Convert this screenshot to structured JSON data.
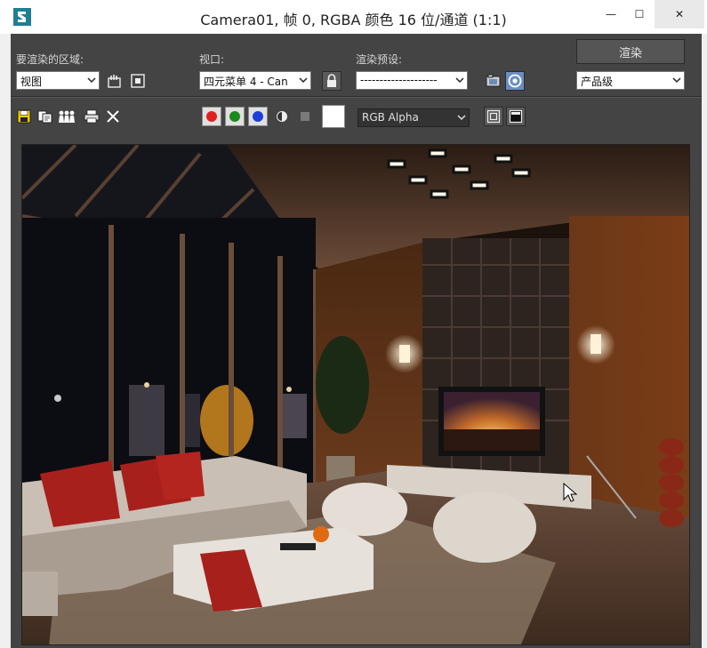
{
  "window": {
    "title": "Camera01, 帧 0, RGBA 颜色 16 位/通道 (1:1)",
    "minimize": "—",
    "maximize": "☐",
    "close": "✕"
  },
  "controls": {
    "area_label": "要渲染的区域:",
    "area_value": "视图",
    "viewport_label": "视口:",
    "viewport_value": "四元菜单 4 - Can",
    "preset_label": "渲染预设:",
    "preset_value": "--------------------",
    "render_button": "渲染",
    "quality_value": "产品级",
    "channel_value": "RGB Alpha"
  },
  "icons": {
    "save": "save-icon",
    "copy": "copy-icon",
    "clone": "clone-window-icon",
    "print": "print-icon",
    "clear": "clear-icon",
    "region_edit": "edit-region-icon",
    "auto_region": "auto-region-icon",
    "lock": "lock-icon",
    "setup": "render-setup-icon",
    "env": "environment-icon",
    "display_frame": "display-frame-icon",
    "display_full": "display-full-icon"
  },
  "channels": {
    "red": "#e02020",
    "green": "#1a8a1a",
    "blue": "#1d3fd8"
  }
}
